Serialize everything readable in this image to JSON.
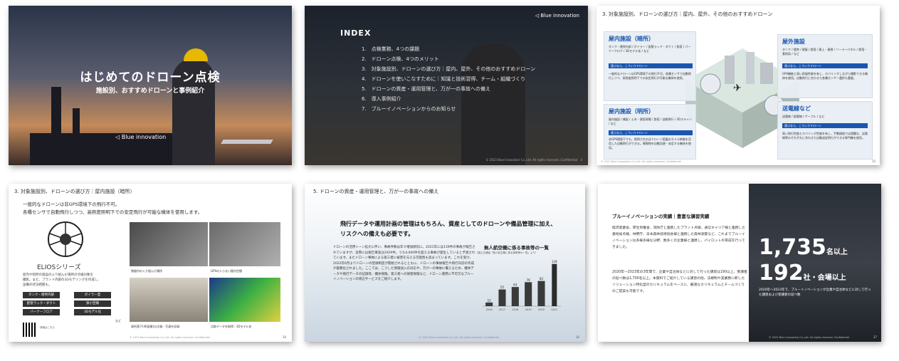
{
  "slide1": {
    "title": "はじめてのドローン点検",
    "subtitle": "施設別、おすすめドローンと事例紹介",
    "logo": "Blue innovation"
  },
  "slide2": {
    "heading": "INDEX",
    "items": [
      "1.　点検業務、4つの課題",
      "2.　ドローン点検、4つのメリット",
      "3.　対象施設別、ドローンの選び方｜屋内、屋外、その他のおすすめドローン",
      "4.　ドローンを使いこなすために｜知識と技術習得、チーム・組織づくり",
      "5.　ドローンの資産・運用管理と、万が一の事故への備え",
      "6.　導入事例紹介",
      "7.　ブルーイノベーションからのお知らせ"
    ],
    "logo": "Blue innovation",
    "footer": "© 2023 Blue Innovation Co.,Ltd. All rights reserved. Confidential",
    "page": "3"
  },
  "slide3": {
    "heading": "3. 対象施設別、ドローンの選び方｜屋内、屋外、その他のおすすめドローン",
    "indoor_dark": {
      "title": "屋内施設（暗所）",
      "tags": "タンク・煙突内部 / ボイラー / 配管ラック・ダクト / 鉄塔 / パーナーフロア / 3Dモデル化 / など",
      "bar": "適ぶなら、こういうドローン",
      "text": "一般的なドローンはGPS環境下の飛行不可。各種センサで自動飛行しつつ、高照度照明下での安定飛行が可能な機体を使用。"
    },
    "indoor_lit": {
      "title": "屋内施設（明所）",
      "tags": "屋内施設 / 橋梁 / 土木・建設現場 / 鉄塔 / 自動飛行 / 3Dスキャン / など",
      "bar": "適ぶなら、こういうドローン",
      "text": "非GPS環境下でも、照明されればドローン搭載のカメラ映像を活用した自動飛行ができる。障害物を自動回避・安定する機体を使用。"
    },
    "outdoor": {
      "title": "屋外施設",
      "tags": "タンク / 煙突 / 建屋 / 鉄塔 / 屋上・屋根 / ソーラーパネル / 鉄塔・基地局 / など",
      "bar": "適ぶなら、こういうドローン",
      "text": "GPS機能と高い耐風性能を有し、ホバリングしながら撮影できる機体を使用。自動飛行に合わせた各種センサー選択も重要。"
    },
    "power": {
      "title": "送電線など",
      "tags": "送電線 / 配電線 / ケーブル / など",
      "bar": "適ぶなら、こういうドローン",
      "text": "高い飛行性能とホバリング性能を有し、手動操縦では困難な、送電線等のそれぞれに合わせた自動追従飛行ができる専門機を使用。"
    },
    "footer": "© 2023 Blue Innovation Co.,Ltd. All rights reserved. Confidential",
    "page": "15"
  },
  "slide4": {
    "heading": "3. 対象施設別、ドローンの選び方｜屋内施設（暗所）",
    "intro": [
      "一般的なドローンは非GPS環境下の飛行不可。",
      "各種センサで自動飛行しつつ、高照度照明下での安定飛行が可能な機体を使用します。"
    ],
    "series": "ELIOSシリーズ",
    "desc": [
      "屋内や暗所の施設の入り組んだ場所の点検対象を",
      "撮影。また、プラント内部の3Dモデリングを作成し、",
      "設備の状況把握も。"
    ],
    "chips": [
      "タンク・煙突内部",
      "ボイラー室",
      "配管ラック・ダクト",
      "狭小空間",
      "バーナーフロア",
      "3Dモデル化"
    ],
    "chips_more": "など",
    "captions": [
      "狭隘内の入り組んだ場所",
      "GPSの入らない屋内空間",
      "高所落下(4K画質)の点検・写真を収録",
      "点群データを取得・3Dモデル化"
    ],
    "qr_note": "詳細はこちら",
    "footer": "© 2023 Blue Innovation Co.,Ltd. All rights reserved. Confidential",
    "page": "16"
  },
  "slide5": {
    "heading": "5. ドローンの資産・運用管理と、万が一の事故への備え",
    "lead": [
      "飛行データや運用計画の管理はもちろん、資産としてのドローンや備品管理に加え、",
      "リスクへの備えも必要です。"
    ],
    "para": "ドローンの活用シーン拡大に伴い、事故件数は年々増加傾向に。2021年には139件の事故が報告されていますが、実際には報告事案は2029件。うち4,000件を超える事故が発生していると予測されています。またドローン事故による第三者に被害を与える可能性も高まっています。これを受け、2022年6月よりドローンの登録制度が開始されるとともに、ドローンの事故報告や飛行日誌の作成が義務化されました。ここでは、こうした保険加入の対応や、万が一の事故に備えるため、機体データや飛行データの記録等、機体保険、第三者への損害保険など、ドローン運用に不可欠なブルーイノベーションの周辺サービスをご紹介します。",
    "footer": "© 2023 Blue Innovation Co.,Ltd. All rights reserved. Confidential",
    "page": "26"
  },
  "slide6": {
    "heading": "ブルーイノベーションの実績｜豊富な講習実績",
    "p1": "経済産業省、厚生労働省、消防庁と連携したプラント点検、通信キャリア様と連携した基地局点検、林野庁、日本森林技術協会様と連携した森林測量など、これまでブルーイノベーションは多様多様な分野、数多くの企業様と連携し、パイロットの育成を行ってきました。",
    "p2": "2020年〜2023年の3年間で、企業や自治体などに対して行った講習は190以上、受講者の延べ数は1,700名以上。本資料でご紹介している講習の他、法規制や実業務に即したソリューション特化型のカリキュラムをベースに、最適なカリキュラムとチームづくりのご提案も可能です。",
    "stat1_value": "1,735",
    "stat1_unit": "名以上",
    "stat2_value": "192",
    "stat2_unit": "社・会場以上",
    "stat_note": "2020年〜2023年で、ブルーイノベーションが企業や自治体などに対して行った講習および受講者の延べ数",
    "footer": "© 2023 Blue Innovation Co.,Ltd. All rights reserved. Confidential",
    "page": "37"
  },
  "chart_data": {
    "type": "bar",
    "title": "無人航空機に係る事故等の一覧",
    "subtitle": "（国土交通省「無人航空機に係る事故等の一覧」より）",
    "categories": [
      "2016",
      "2017",
      "2018",
      "2019",
      "2020",
      "2021"
    ],
    "values": [
      12,
      55,
      63,
      79,
      83,
      51
    ],
    "extra": {
      "category": "2021",
      "value": 139
    },
    "ylim": [
      0,
      150
    ]
  }
}
